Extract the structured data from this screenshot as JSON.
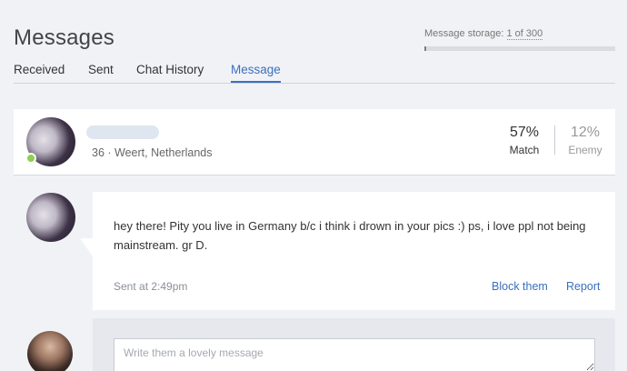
{
  "header": {
    "title": "Messages",
    "storage_label": "Message storage:",
    "storage_count": "1 of 300",
    "storage_fraction": 0.0033
  },
  "tabs": [
    {
      "label": "Received"
    },
    {
      "label": "Sent"
    },
    {
      "label": "Chat History"
    },
    {
      "label": "Message",
      "active": true
    }
  ],
  "profile": {
    "meta": "36 · Weert, Netherlands",
    "online": true,
    "match": {
      "value": "57%",
      "label": "Match"
    },
    "enemy": {
      "value": "12%",
      "label": "Enemy"
    }
  },
  "message": {
    "text": "hey there! Pity you live in Germany b/c i think i drown in your pics :) ps, i love ppl not being mainstream. gr D.",
    "sent_at": "Sent at 2:49pm",
    "block_label": "Block them",
    "report_label": "Report"
  },
  "compose": {
    "placeholder": "Write them a lovely message"
  },
  "colors": {
    "accent": "#3b6fc0",
    "online": "#8bd24f",
    "background": "#f1f2f6"
  }
}
